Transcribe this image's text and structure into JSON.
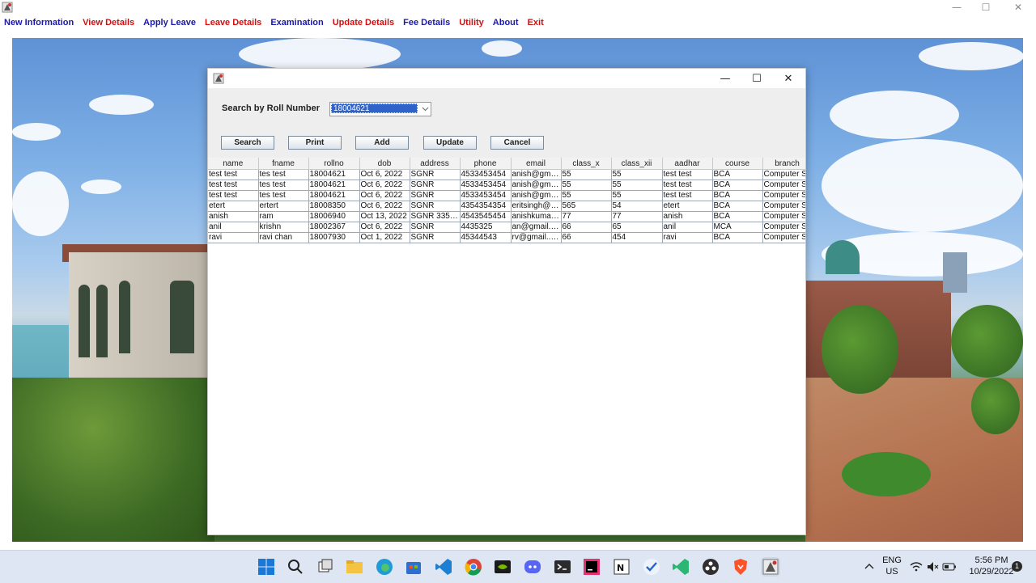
{
  "menu": [
    {
      "label": "New Information",
      "color": "#1a1aa6"
    },
    {
      "label": "View Details",
      "color": "#d01010"
    },
    {
      "label": "Apply Leave",
      "color": "#1a1aa6"
    },
    {
      "label": "Leave Details",
      "color": "#d01010"
    },
    {
      "label": "Examination",
      "color": "#1a1aa6"
    },
    {
      "label": "Update Details",
      "color": "#d01010"
    },
    {
      "label": "Fee Details",
      "color": "#1a1aa6"
    },
    {
      "label": "Utility",
      "color": "#d01010"
    },
    {
      "label": "About",
      "color": "#1a1aa6"
    },
    {
      "label": "Exit",
      "color": "#d01010"
    }
  ],
  "window_controls": {
    "minimize": "—",
    "maximize": "☐",
    "close": "✕"
  },
  "dialog": {
    "search_label": "Search by Roll Number",
    "roll_number_selected": "18004621",
    "buttons": {
      "search": "Search",
      "print": "Print",
      "add": "Add",
      "update": "Update",
      "cancel": "Cancel"
    },
    "table": {
      "columns": [
        "name",
        "fname",
        "rollno",
        "dob",
        "address",
        "phone",
        "email",
        "class_x",
        "class_xii",
        "aadhar",
        "course",
        "branch"
      ],
      "rows": [
        [
          "test test",
          "tes test",
          "18004621",
          "Oct 6, 2022",
          "SGNR",
          "4533453454",
          "anish@gmai...",
          "55",
          "55",
          "test test",
          "BCA",
          "Computer S"
        ],
        [
          "test test",
          "tes test",
          "18004621",
          "Oct 6, 2022",
          "SGNR",
          "4533453454",
          "anish@gmai...",
          "55",
          "55",
          "test test",
          "BCA",
          "Computer S"
        ],
        [
          "test test",
          "tes test",
          "18004621",
          "Oct 6, 2022",
          "SGNR",
          "4533453454",
          "anish@gmai...",
          "55",
          "55",
          "test test",
          "BCA",
          "Computer S"
        ],
        [
          "etert",
          "ertert",
          "18008350",
          "Oct 6, 2022",
          "SGNR",
          "4354354354",
          "eritsingh@g...",
          "565",
          "54",
          "etert",
          "BCA",
          "Computer S"
        ],
        [
          "anish",
          "ram",
          "18006940",
          "Oct 13, 2022",
          "SGNR 3350...",
          "4543545454",
          "anishkumar...",
          "77",
          "77",
          "anish",
          "BCA",
          "Computer S"
        ],
        [
          "anil",
          "krishn",
          "18002367",
          "Oct 6, 2022",
          "SGNR",
          "4435325",
          "an@gmail.c...",
          "66",
          "65",
          "anil",
          "MCA",
          "Computer S"
        ],
        [
          "ravi",
          "ravi chan",
          "18007930",
          "Oct 1, 2022",
          "SGNR",
          "45344543",
          "rv@gmail..c...",
          "66",
          "454",
          "ravi",
          "BCA",
          "Computer S"
        ]
      ]
    }
  },
  "taskbar": {
    "icons": [
      "windows-start-icon",
      "search-icon",
      "task-view-icon",
      "file-explorer-icon",
      "edge-browser-icon",
      "store-icon",
      "vscode-icon",
      "chrome-icon",
      "nvidia-icon",
      "discord-icon",
      "terminal-icon",
      "intellij-icon",
      "notepad-icon",
      "todo-icon",
      "visual-studio-icon",
      "obs-icon",
      "brave-icon",
      "java-app-icon"
    ],
    "lang_top": "ENG",
    "lang_bottom": "US",
    "time": "5:56 PM",
    "date": "10/29/2022",
    "notification_count": "1"
  }
}
